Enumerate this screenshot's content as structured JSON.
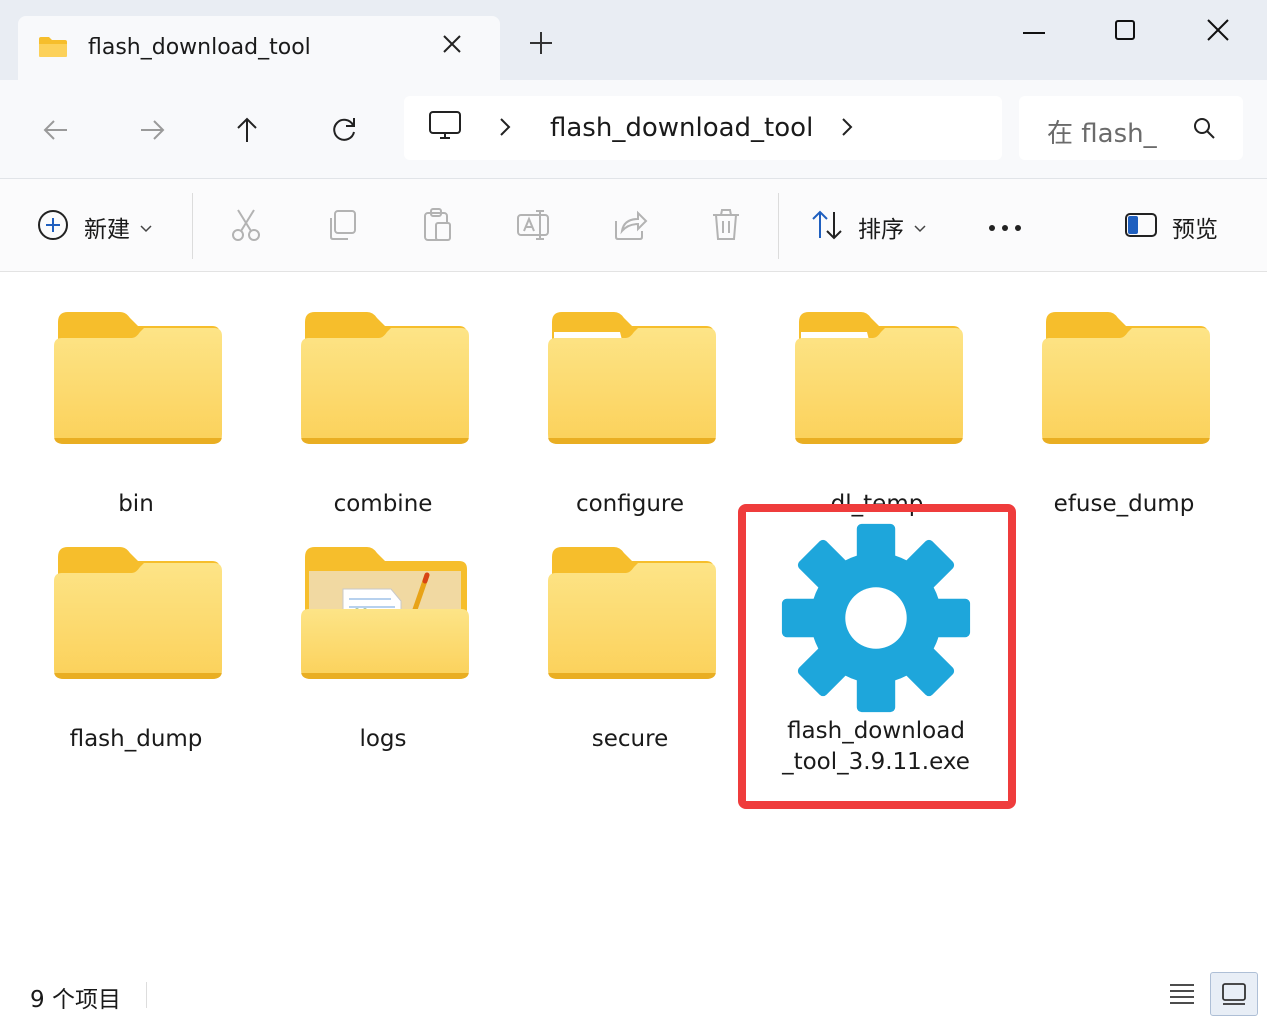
{
  "window": {
    "tab_title": "flash_download_tool",
    "tab_close_icon": "close-icon",
    "new_tab_icon": "plus-icon",
    "controls": [
      "minimize-icon",
      "maximize-icon",
      "close-icon"
    ]
  },
  "nav": {
    "back_icon": "arrow-left-icon",
    "forward_icon": "arrow-right-icon",
    "up_icon": "arrow-up-icon",
    "refresh_icon": "refresh-icon",
    "address": {
      "root_icon": "this-pc-icon",
      "segments": [
        "flash_download_tool"
      ]
    },
    "search_placeholder": "在 flash_"
  },
  "toolbar": {
    "new_label": "新建",
    "sort_label": "排序",
    "preview_label": "预览",
    "disabled_actions": [
      "cut-icon",
      "copy-icon",
      "paste-icon",
      "rename-icon",
      "share-icon",
      "delete-icon"
    ],
    "more_icon": "more-icon"
  },
  "items": [
    {
      "name": "bin",
      "type": "folder"
    },
    {
      "name": "combine",
      "type": "folder"
    },
    {
      "name": "configure",
      "type": "folder"
    },
    {
      "name": "dl_temp",
      "type": "folder"
    },
    {
      "name": "efuse_dump",
      "type": "folder"
    },
    {
      "name": "flash_dump",
      "type": "folder"
    },
    {
      "name": "logs",
      "type": "folder-with-files"
    },
    {
      "name": "secure",
      "type": "folder"
    },
    {
      "name": "flash_download_tool_3.9.11.exe",
      "name_line1": "flash_download",
      "name_line2": "_tool_3.9.11.exe",
      "type": "executable",
      "highlighted": true
    }
  ],
  "status": {
    "item_count": "9 个项目",
    "views": [
      "details-view-icon",
      "large-icons-view-icon"
    ],
    "active_view": "large-icons-view-icon"
  },
  "colors": {
    "folder_back": "#f6be2c",
    "folder_front": "#fcd667",
    "gear": "#1ea6db",
    "highlight": "#ef3c3c"
  }
}
